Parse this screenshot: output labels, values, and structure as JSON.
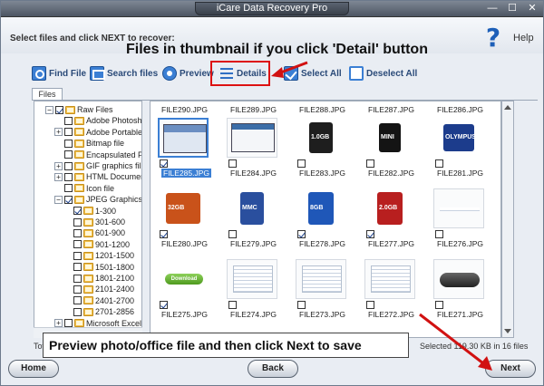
{
  "window": {
    "title": "iCare Data Recovery Pro",
    "controls": [
      "—",
      "☐",
      "✕"
    ]
  },
  "header": {
    "instruction": "Select files and click NEXT to recover:",
    "help_glyph": "?",
    "help_label": "Help"
  },
  "annotations": {
    "top": "Files in thumbnail if you click 'Detail' button",
    "bottom": "Preview photo/office file and then click Next to save",
    "arrow_color": "#d11111"
  },
  "toolbar": {
    "find_file": "Find File",
    "search_files": "Search files",
    "preview": "Preview",
    "details": "Details",
    "select_all": "Select All",
    "deselect_all": "Deselect All"
  },
  "tabs": {
    "files": "Files"
  },
  "tree": {
    "items": [
      {
        "label": "Raw Files",
        "expander": "−",
        "checked": true,
        "indent": 0
      },
      {
        "label": "Adobe Photosh",
        "expander": "",
        "checked": false,
        "indent": 1
      },
      {
        "label": "Adobe Portable",
        "expander": "+",
        "checked": false,
        "indent": 1
      },
      {
        "label": "Bitmap file",
        "expander": "",
        "checked": false,
        "indent": 1
      },
      {
        "label": "Encapsulated P",
        "expander": "",
        "checked": false,
        "indent": 1
      },
      {
        "label": "GIF graphics fil",
        "expander": "+",
        "checked": false,
        "indent": 1
      },
      {
        "label": "HTML Documen",
        "expander": "+",
        "checked": false,
        "indent": 1
      },
      {
        "label": "Icon file",
        "expander": "",
        "checked": false,
        "indent": 1
      },
      {
        "label": "JPEG Graphics I",
        "expander": "−",
        "checked": true,
        "indent": 1
      },
      {
        "label": "1-300",
        "expander": "",
        "checked": true,
        "indent": 2
      },
      {
        "label": "301-600",
        "expander": "",
        "checked": false,
        "indent": 2
      },
      {
        "label": "601-900",
        "expander": "",
        "checked": false,
        "indent": 2
      },
      {
        "label": "901-1200",
        "expander": "",
        "checked": false,
        "indent": 2
      },
      {
        "label": "1201-1500",
        "expander": "",
        "checked": false,
        "indent": 2
      },
      {
        "label": "1501-1800",
        "expander": "",
        "checked": false,
        "indent": 2
      },
      {
        "label": "1801-2100",
        "expander": "",
        "checked": false,
        "indent": 2
      },
      {
        "label": "2101-2400",
        "expander": "",
        "checked": false,
        "indent": 2
      },
      {
        "label": "2401-2700",
        "expander": "",
        "checked": false,
        "indent": 2
      },
      {
        "label": "2701-2856",
        "expander": "",
        "checked": false,
        "indent": 2
      },
      {
        "label": "Microsoft Excel",
        "expander": "+",
        "checked": false,
        "indent": 1
      }
    ]
  },
  "grid": {
    "header_row": [
      "FILE290.JPG",
      "FILE289.JPG",
      "FILE288.JPG",
      "FILE287.JPG",
      "FILE286.JPG"
    ],
    "rows": [
      [
        {
          "name": "FILE285.JPG",
          "checked": true,
          "selected": true,
          "kind": "screenshot"
        },
        {
          "name": "FILE284.JPG",
          "checked": false,
          "selected": false,
          "kind": "screenshot2"
        },
        {
          "name": "FILE283.JPG",
          "checked": false,
          "selected": false,
          "kind": "card-black",
          "text": "1.0GB"
        },
        {
          "name": "FILE282.JPG",
          "checked": false,
          "selected": false,
          "kind": "card-mini",
          "text": "MINI"
        },
        {
          "name": "FILE281.JPG",
          "checked": false,
          "selected": false,
          "kind": "card-olympus",
          "text": "OLYMPUS"
        }
      ],
      [
        {
          "name": "FILE280.JPG",
          "checked": true,
          "selected": false,
          "kind": "card-cf",
          "text": "32GB"
        },
        {
          "name": "FILE279.JPG",
          "checked": false,
          "selected": false,
          "kind": "card-mmc",
          "text": "MMC"
        },
        {
          "name": "FILE278.JPG",
          "checked": true,
          "selected": false,
          "kind": "card-sd-blue",
          "text": "8GB"
        },
        {
          "name": "FILE277.JPG",
          "checked": true,
          "selected": false,
          "kind": "card-sd-red",
          "text": "2.0GB"
        },
        {
          "name": "FILE276.JPG",
          "checked": false,
          "selected": false,
          "kind": "blank"
        }
      ],
      [
        {
          "name": "FILE275.JPG",
          "checked": true,
          "selected": false,
          "kind": "download",
          "text": "Download"
        },
        {
          "name": "FILE274.JPG",
          "checked": false,
          "selected": false,
          "kind": "doc"
        },
        {
          "name": "FILE273.JPG",
          "checked": false,
          "selected": false,
          "kind": "doc"
        },
        {
          "name": "FILE272.JPG",
          "checked": false,
          "selected": false,
          "kind": "doc"
        },
        {
          "name": "FILE271.JPG",
          "checked": false,
          "selected": false,
          "kind": "phone"
        }
      ]
    ]
  },
  "status": {
    "left": "Tota",
    "right": "Selected 119.30 KB in 16 files"
  },
  "buttons": {
    "home": "Home",
    "back": "Back",
    "next": "Next"
  }
}
